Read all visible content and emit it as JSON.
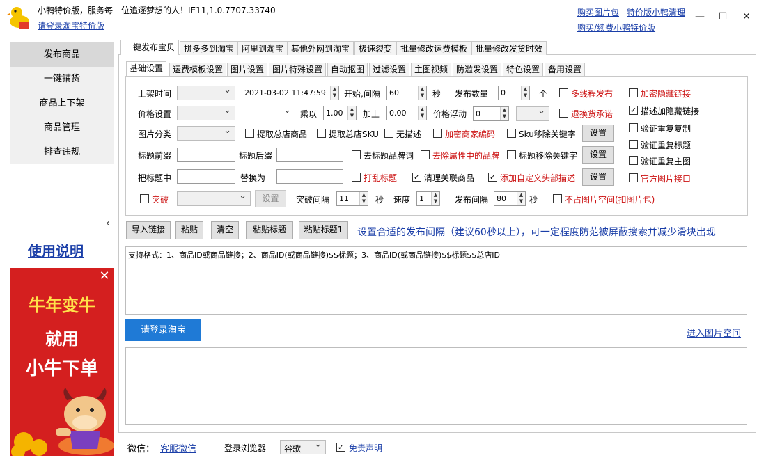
{
  "window": {
    "title": "小鸭特价版，服务每一位追逐梦想的人！IE11,1.0.7707.33740",
    "login_link": "请登录淘宝特价版",
    "top_links": [
      "购买图片包",
      "特价版小鸭清理",
      "购买/续费小鸭特价版"
    ],
    "controls": {
      "minimize": "—",
      "maximize": "☐",
      "close": "✕"
    }
  },
  "sidebar": {
    "items": [
      {
        "label": "发布商品",
        "active": true
      },
      {
        "label": "一键铺货"
      },
      {
        "label": "商品上下架"
      },
      {
        "label": "商品管理"
      },
      {
        "label": "排查违规"
      }
    ],
    "collapse_glyph": "‹",
    "help_link": "使用说明",
    "ad": {
      "line1": "牛年变牛",
      "line2": "就用",
      "line3": "小牛下单",
      "close": "✕"
    }
  },
  "tabs": [
    "一键发布宝贝",
    "拼多多到淘宝",
    "阿里到淘宝",
    "其他外网到淘宝",
    "极速裂变",
    "批量修改运费模板",
    "批量修改发货时效"
  ],
  "subtabs": [
    "基础设置",
    "运费模板设置",
    "图片设置",
    "图片特殊设置",
    "自动抠图",
    "过滤设置",
    "主图视频",
    "防滥发设置",
    "特色设置",
    "备用设置"
  ],
  "form": {
    "shelf_time_label": "上架时间",
    "datetime_value": "2021-03-02 11:47:59",
    "start_interval_label": "开始,间隔",
    "interval_value": "60",
    "sec": "秒",
    "publish_count_label": "发布数量",
    "publish_count_value": "0",
    "ge": "个",
    "multithread_label": "多线程发布",
    "price_setting_label": "价格设置",
    "multiply_label": "乘以",
    "multiply_value": "1.00",
    "add_label": "加上",
    "add_value": "0.00",
    "price_float_label": "价格浮动",
    "price_float_value": "0",
    "return_promise_label": "退换货承诺",
    "image_category_label": "图片分类",
    "fetch_total_goods_label": "提取总店商品",
    "fetch_total_sku_label": "提取总店SKU",
    "no_desc_label": "无描述",
    "encrypt_code_label": "加密商家编码",
    "sku_remove_kw_label": "Sku移除关键字",
    "settings_btn": "设置",
    "title_prefix_label": "标题前缀",
    "title_suffix_label": "标题后缀",
    "remove_brand_label": "去标题品牌词",
    "remove_attr_brand_label": "去除属性中的品牌",
    "title_remove_kw_label": "标题移除关键字",
    "title_contains_label": "把标题中",
    "replace_with_label": "替换为",
    "shuffle_title_label": "打乱标题",
    "clean_related_label": "清理关联商品",
    "add_custom_header_label": "添加自定义头部描述",
    "breakthrough_label": "突破",
    "breakthrough_interval_label": "突破间隔",
    "breakthrough_interval_value": "11",
    "speed_label": "速度",
    "speed_value": "1",
    "publish_interval_label": "发布间隔",
    "publish_interval_value": "80",
    "no_img_space_label": "不占图片空间(扣图片包)",
    "right_col": [
      {
        "label": "加密隐藏链接",
        "red": true,
        "checked": false
      },
      {
        "label": "描述加隐藏链接",
        "red": false,
        "checked": true
      },
      {
        "label": "验证重复复制",
        "red": false,
        "checked": false
      },
      {
        "label": "验证重复标题",
        "red": false,
        "checked": false
      },
      {
        "label": "验证重复主图",
        "red": false,
        "checked": false
      },
      {
        "label": "官方图片接口",
        "red": true,
        "checked": false
      }
    ]
  },
  "actions": {
    "import_link": "导入链接",
    "paste": "粘贴",
    "clear": "清空",
    "paste_title": "粘贴标题",
    "paste_title1": "粘贴标题1",
    "hint": "设置合适的发布间隔（建议60秒以上），可一定程度防范被屏蔽搜索并减少滑块出现"
  },
  "link_box_text": "支持格式：1、商品ID或商品链接；2、商品ID(或商品链接)$$标题；3、商品ID(或商品链接)$$标题$$总店ID",
  "login_taobao_btn": "请登录淘宝",
  "enter_image_space": "进入图片空间",
  "footer": {
    "wechat_label": "微信：",
    "wechat_link": "客服微信",
    "browser_label": "登录浏览器",
    "browser_value": "谷歌",
    "disclaimer": "免责声明"
  },
  "colors": {
    "accent_blue": "#1f7ad6",
    "link_blue": "#1a3ea8",
    "warn_red": "#cc1111",
    "ad_red": "#d41f1f"
  }
}
